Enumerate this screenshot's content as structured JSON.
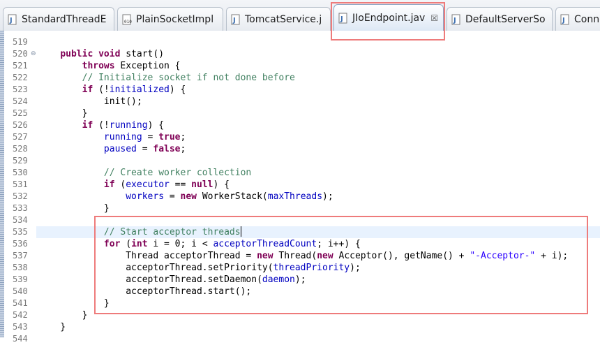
{
  "tabs": [
    {
      "label": "StandardThreadE",
      "icon": "java-file-icon",
      "active": false
    },
    {
      "label": "PlainSocketImpl",
      "icon": "class-file-icon",
      "active": false
    },
    {
      "label": "TomcatService.j",
      "icon": "java-file-icon",
      "active": false
    },
    {
      "label": "JIoEndpoint.jav",
      "icon": "java-file-icon",
      "active": true,
      "close": "☒"
    },
    {
      "label": "DefaultServerSo",
      "icon": "java-file-icon",
      "active": false
    },
    {
      "label": "Conne",
      "icon": "java-file-icon",
      "active": false
    }
  ],
  "editor": {
    "current_line": 535,
    "lines": [
      {
        "n": "519",
        "tokens": [
          {
            "t": ""
          }
        ]
      },
      {
        "n": "520",
        "fold": "⊖",
        "tokens": [
          {
            "t": "    "
          },
          {
            "t": "public",
            "c": "kw"
          },
          {
            "t": " "
          },
          {
            "t": "void",
            "c": "kw"
          },
          {
            "t": " start()"
          }
        ]
      },
      {
        "n": "521",
        "tokens": [
          {
            "t": "        "
          },
          {
            "t": "throws",
            "c": "kw"
          },
          {
            "t": " Exception {"
          }
        ]
      },
      {
        "n": "522",
        "tokens": [
          {
            "t": "        "
          },
          {
            "t": "// Initialize socket if not done before",
            "c": "cm"
          }
        ]
      },
      {
        "n": "523",
        "tokens": [
          {
            "t": "        "
          },
          {
            "t": "if",
            "c": "kw"
          },
          {
            "t": " (!"
          },
          {
            "t": "initialized",
            "c": "fd"
          },
          {
            "t": ") {"
          }
        ]
      },
      {
        "n": "524",
        "tokens": [
          {
            "t": "            init();"
          }
        ]
      },
      {
        "n": "525",
        "tokens": [
          {
            "t": "        }"
          }
        ]
      },
      {
        "n": "526",
        "tokens": [
          {
            "t": "        "
          },
          {
            "t": "if",
            "c": "kw"
          },
          {
            "t": " (!"
          },
          {
            "t": "running",
            "c": "fd"
          },
          {
            "t": ") {"
          }
        ]
      },
      {
        "n": "527",
        "tokens": [
          {
            "t": "            "
          },
          {
            "t": "running",
            "c": "fd"
          },
          {
            "t": " = "
          },
          {
            "t": "true",
            "c": "kw"
          },
          {
            "t": ";"
          }
        ]
      },
      {
        "n": "528",
        "tokens": [
          {
            "t": "            "
          },
          {
            "t": "paused",
            "c": "fd"
          },
          {
            "t": " = "
          },
          {
            "t": "false",
            "c": "kw"
          },
          {
            "t": ";"
          }
        ]
      },
      {
        "n": "529",
        "tokens": [
          {
            "t": ""
          }
        ]
      },
      {
        "n": "530",
        "tokens": [
          {
            "t": "            "
          },
          {
            "t": "// Create worker collection",
            "c": "cm"
          }
        ]
      },
      {
        "n": "531",
        "tokens": [
          {
            "t": "            "
          },
          {
            "t": "if",
            "c": "kw"
          },
          {
            "t": " ("
          },
          {
            "t": "executor",
            "c": "fd"
          },
          {
            "t": " == "
          },
          {
            "t": "null",
            "c": "kw"
          },
          {
            "t": ") {"
          }
        ]
      },
      {
        "n": "532",
        "tokens": [
          {
            "t": "                "
          },
          {
            "t": "workers",
            "c": "fd"
          },
          {
            "t": " = "
          },
          {
            "t": "new",
            "c": "kw"
          },
          {
            "t": " WorkerStack("
          },
          {
            "t": "maxThreads",
            "c": "fd"
          },
          {
            "t": ");"
          }
        ]
      },
      {
        "n": "533",
        "tokens": [
          {
            "t": "            }"
          }
        ]
      },
      {
        "n": "534",
        "tokens": [
          {
            "t": ""
          }
        ]
      },
      {
        "n": "535",
        "caret": true,
        "tokens": [
          {
            "t": "            "
          },
          {
            "t": "// Start acceptor threads",
            "c": "cm"
          }
        ]
      },
      {
        "n": "536",
        "tokens": [
          {
            "t": "            "
          },
          {
            "t": "for",
            "c": "kw"
          },
          {
            "t": " ("
          },
          {
            "t": "int",
            "c": "kw"
          },
          {
            "t": " i = 0; i < "
          },
          {
            "t": "acceptorThreadCount",
            "c": "fd"
          },
          {
            "t": "; i++) {"
          }
        ]
      },
      {
        "n": "537",
        "tokens": [
          {
            "t": "                Thread acceptorThread = "
          },
          {
            "t": "new",
            "c": "kw"
          },
          {
            "t": " Thread("
          },
          {
            "t": "new",
            "c": "kw"
          },
          {
            "t": " Acceptor(), getName() + "
          },
          {
            "t": "\"-Acceptor-\"",
            "c": "st"
          },
          {
            "t": " + i);"
          }
        ]
      },
      {
        "n": "538",
        "tokens": [
          {
            "t": "                acceptorThread.setPriority("
          },
          {
            "t": "threadPriority",
            "c": "fd"
          },
          {
            "t": ");"
          }
        ]
      },
      {
        "n": "539",
        "tokens": [
          {
            "t": "                acceptorThread.setDaemon("
          },
          {
            "t": "daemon",
            "c": "fd"
          },
          {
            "t": ");"
          }
        ]
      },
      {
        "n": "540",
        "tokens": [
          {
            "t": "                acceptorThread.start();"
          }
        ]
      },
      {
        "n": "541",
        "tokens": [
          {
            "t": "            }"
          }
        ]
      },
      {
        "n": "542",
        "tokens": [
          {
            "t": "        }"
          }
        ]
      },
      {
        "n": "543",
        "tokens": [
          {
            "t": "    }"
          }
        ]
      },
      {
        "n": "544",
        "tokens": [
          {
            "t": ""
          }
        ]
      }
    ]
  }
}
